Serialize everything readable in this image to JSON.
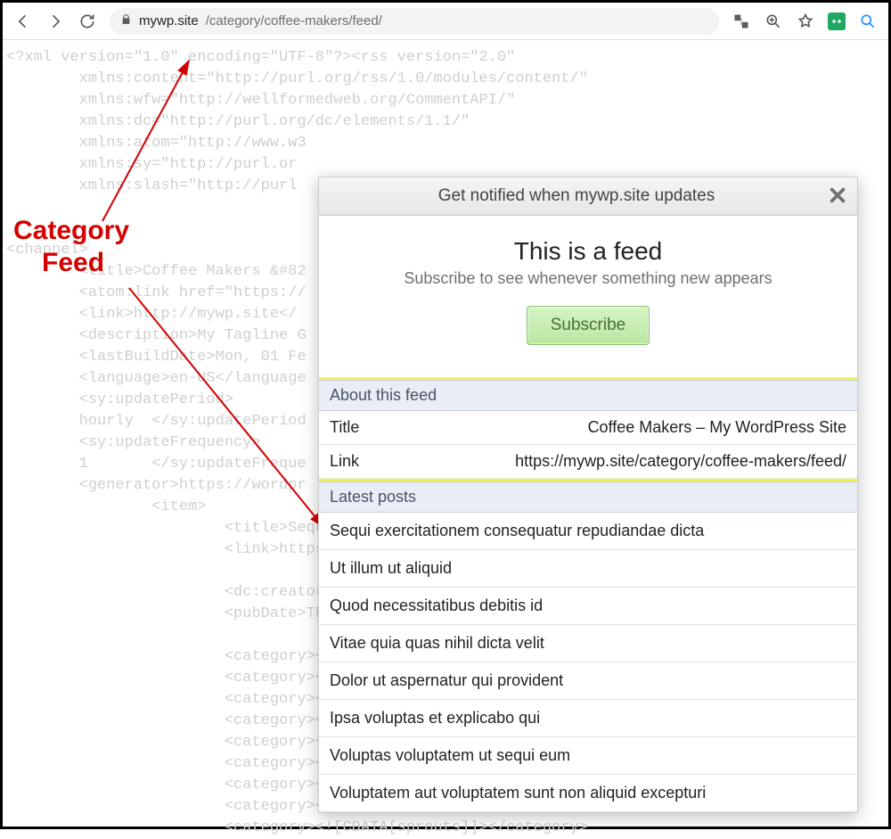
{
  "toolbar": {
    "url_domain": "mywp.site",
    "url_path": "/category/coffee-makers/feed/"
  },
  "annotation": {
    "line1": "Category",
    "line2": "Feed"
  },
  "xml": "<?xml version=\"1.0\" encoding=\"UTF-8\"?><rss version=\"2.0\"\n        xmlns:content=\"http://purl.org/rss/1.0/modules/content/\"\n        xmlns:wfw=\"http://wellformedweb.org/CommentAPI/\"\n        xmlns:dc=\"http://purl.org/dc/elements/1.1/\"\n        xmlns:atom=\"http://www.w3\n        xmlns:sy=\"http://purl.or\n        xmlns:slash=\"http://purl\n\n\n<channel>\n        <title>Coffee Makers &#82\n        <atom:link href=\"https://                                               \"app\n        <link>http://mywp.site</\n        <description>My Tagline G\n        <lastBuildDate>Mon, 01 Fe\n        <language>en-US</language\n        <sy:updatePeriod>\n        hourly  </sy:updatePeriod\n        <sy:updateFrequency>\n        1       </sy:updateFreque\n        <generator>https://wordpr\n                <item>\n                        <title>Sequi exer\n                        <link>https://myw                                            ta/</\n\n                        <dc:creator><![CD\n                        <pubDate>Thu, 04 \n\n                        <category><![CDAT\n                        <category><![CDAT\n                        <category><![CDAT\n                        <category><![CDAT\n                        <category><![CDAT\n                        <category><![CDAT\n                        <category><![CDAT\n                        <category><![CDAT\n                        <category><![CDATA[sprouts]]></category>",
  "panel": {
    "head": "Get notified when mywp.site updates",
    "title": "This is a feed",
    "subtitle": "Subscribe to see whenever something new appears",
    "subscribe": "Subscribe",
    "about_head": "About this feed",
    "title_label": "Title",
    "title_value": "Coffee Makers – My WordPress Site",
    "link_label": "Link",
    "link_value": "https://mywp.site/category/coffee-makers/feed/",
    "latest_head": "Latest posts",
    "posts": [
      "Sequi exercitationem consequatur repudiandae dicta",
      "Ut illum ut aliquid",
      "Quod necessitatibus debitis id",
      "Vitae quia quas nihil dicta velit",
      "Dolor ut aspernatur qui provident",
      "Ipsa voluptas et explicabo qui",
      "Voluptas voluptatem ut sequi eum",
      "Voluptatem aut voluptatem sunt non aliquid excepturi"
    ]
  }
}
